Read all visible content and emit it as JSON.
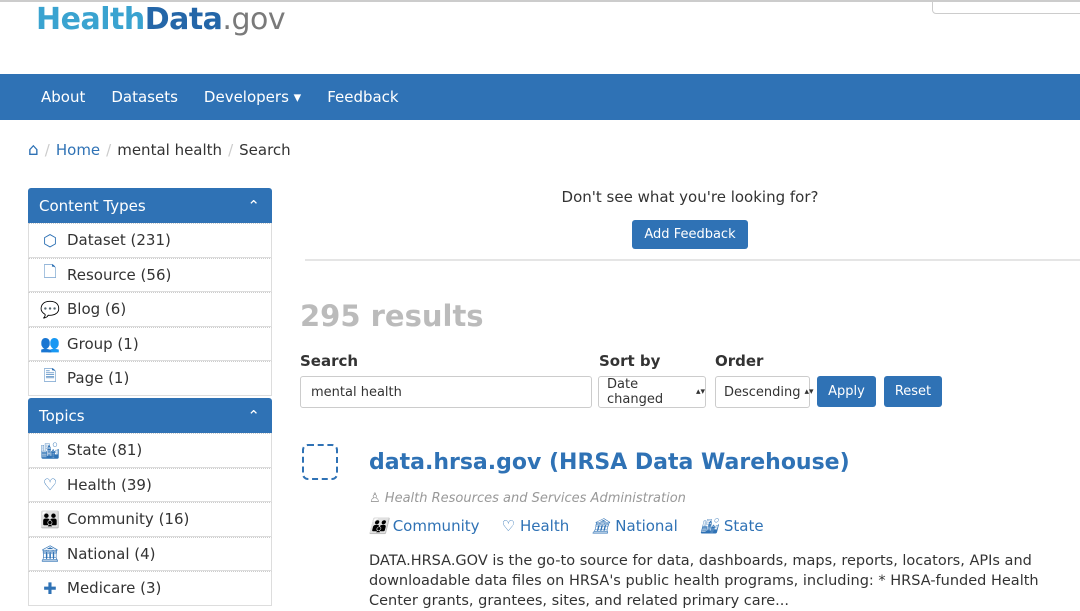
{
  "logo": {
    "part1": "Health",
    "part2": "Data",
    "part3": ".gov"
  },
  "nav": [
    "About",
    "Datasets",
    "Developers ▾",
    "Feedback"
  ],
  "breadcrumb": {
    "home": "Home",
    "term": "mental health",
    "current": "Search"
  },
  "sidebar": {
    "content_types": {
      "title": "Content Types",
      "items": [
        {
          "icon": "cube-icon",
          "glyph": "⬡",
          "label": "Dataset (231)"
        },
        {
          "icon": "file-code-icon",
          "glyph": "🗋",
          "label": "Resource (56)"
        },
        {
          "icon": "chat-bubble-icon",
          "glyph": "💬",
          "label": "Blog (6)"
        },
        {
          "icon": "group-icon",
          "glyph": "👥",
          "label": "Group (1)"
        },
        {
          "icon": "page-icon",
          "glyph": "🗎",
          "label": "Page (1)"
        }
      ]
    },
    "topics": {
      "title": "Topics",
      "items": [
        {
          "icon": "buildings-icon",
          "glyph": "🏙",
          "label": "State (81)"
        },
        {
          "icon": "heart-icon",
          "glyph": "♡",
          "label": "Health (39)"
        },
        {
          "icon": "community-icon",
          "glyph": "👪",
          "label": "Community (16)"
        },
        {
          "icon": "bank-icon",
          "glyph": "🏛",
          "label": "National (4)"
        },
        {
          "icon": "medical-icon",
          "glyph": "✚",
          "label": "Medicare (3)"
        }
      ]
    }
  },
  "main": {
    "prompt": "Don't see what you're looking for?",
    "feedback_button": "Add Feedback",
    "results": "295 results",
    "search_label": "Search",
    "search_value": "mental health",
    "sort_label": "Sort by",
    "sort_value": "Date changed",
    "order_label": "Order",
    "order_value": "Descending",
    "apply": "Apply",
    "reset": "Reset",
    "result": {
      "title": "data.hrsa.gov (HRSA Data Warehouse)",
      "org": "Health Resources and Services Administration",
      "tags": [
        "Community",
        "Health",
        "National",
        "State"
      ],
      "description": "DATA.HRSA.GOV is the go-to source for data, dashboards, maps, reports, locators, APIs and downloadable data files on HRSA's public health programs, including: * HRSA-funded Health Center grants, grantees, sites, and related primary care..."
    }
  }
}
